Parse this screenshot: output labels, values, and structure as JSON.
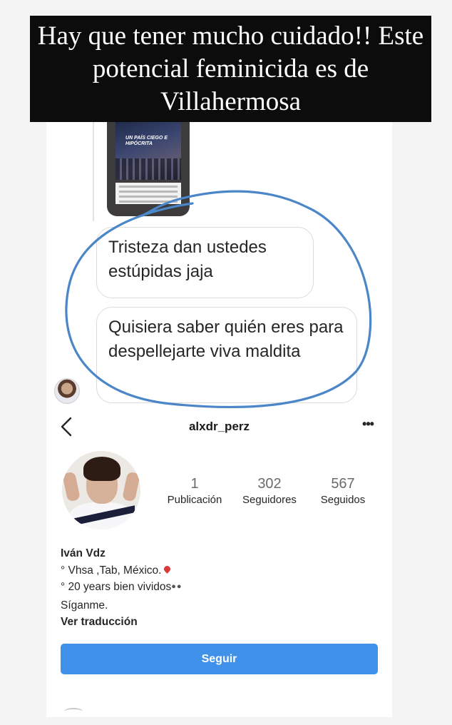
{
  "caption": {
    "text": "Hay que tener mucho cuidado!! Este potencial feminicida es de Villahermosa"
  },
  "dm": {
    "story_title": "UN PAÍS CIEGO E HIPÓCRITA",
    "messages": [
      {
        "text": "Tristeza dan ustedes estúpidas jaja"
      },
      {
        "text": "Quisiera saber quién eres para despellejarte viva maldita"
      }
    ],
    "annotation_color": "#4a86c8"
  },
  "profile": {
    "username": "alxdr_perz",
    "more_label": "•••",
    "stats": {
      "posts": {
        "value": "1",
        "label": "Publicación"
      },
      "followers": {
        "value": "302",
        "label": "Seguidores"
      },
      "following": {
        "value": "567",
        "label": "Seguidos"
      }
    },
    "bio": {
      "name": "Iván Vdz",
      "line1": "° Vhsa ,Tab, México.",
      "line2": "° 20 years bien vividos",
      "line3": "Síganme.",
      "translate": "Ver traducción"
    },
    "follow_button": "Seguir",
    "accent_color": "#3f91ea"
  },
  "icons": {
    "back": "chevron-left-icon",
    "more": "more-options-icon",
    "location": "location-pin-icon",
    "eyes": "eyes-icon"
  }
}
